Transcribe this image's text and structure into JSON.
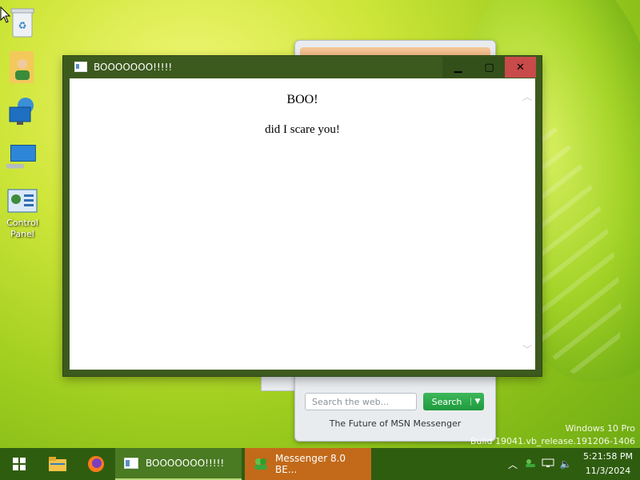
{
  "desktop": {
    "icons": [
      {
        "name": "Recycle Bin",
        "label": ""
      },
      {
        "name": "User Folder",
        "label": ""
      },
      {
        "name": "Network",
        "label": ""
      },
      {
        "name": "This PC",
        "label": ""
      },
      {
        "name": "Control Panel",
        "label": "Control Panel"
      }
    ]
  },
  "dialog": {
    "title": "BOOOOOOO!!!!!",
    "heading": "BOO!",
    "message": "did I scare you!",
    "controls": {
      "minimize": "▁",
      "maximize": "▢",
      "close": "✕"
    }
  },
  "messenger_window": {
    "search_placeholder": "Search the web...",
    "search_button": "Search",
    "tagline": "The Future of MSN Messenger"
  },
  "watermark": {
    "line1": "Windows 10 Pro",
    "line2": "Build 19041.vb_release.191206-1406"
  },
  "taskbar": {
    "tasks": [
      {
        "label": "BOOOOOOO!!!!!",
        "active": true
      },
      {
        "label": "Messenger 8.0 BE...",
        "active": false
      }
    ],
    "clock": {
      "time": "5:21:58 PM",
      "date": "11/3/2024"
    }
  },
  "colors": {
    "taskbar": "#2f5d10",
    "window_frame": "#3d5a1e",
    "close_button": "#c84a4a",
    "accent_green": "#1f9a3d"
  }
}
